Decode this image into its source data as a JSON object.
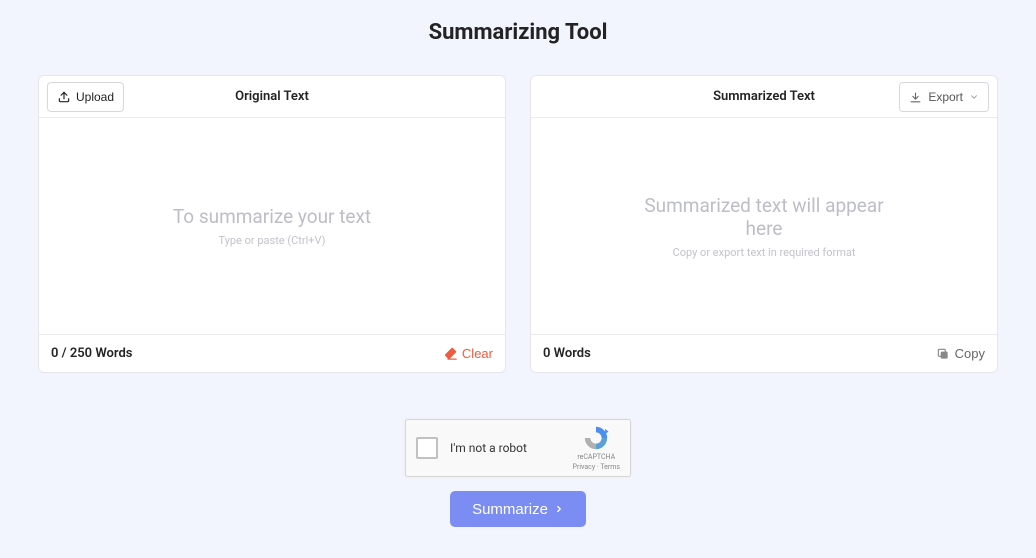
{
  "title": "Summarizing Tool",
  "left": {
    "upload_label": "Upload",
    "header": "Original Text",
    "placeholder_big": "To summarize your text",
    "placeholder_small": "Type or paste (Ctrl+V)",
    "word_count": "0 / 250 Words",
    "clear_label": "Clear"
  },
  "right": {
    "header": "Summarized Text",
    "export_label": "Export",
    "placeholder_big": "Summarized text will appear here",
    "placeholder_small": "Copy or export text in required format",
    "word_count": "0 Words",
    "copy_label": "Copy"
  },
  "recaptcha": {
    "label": "I'm not a robot",
    "brand": "reCAPTCHA",
    "links": "Privacy  ·  Terms"
  },
  "action": {
    "summarize_label": "Summarize"
  }
}
